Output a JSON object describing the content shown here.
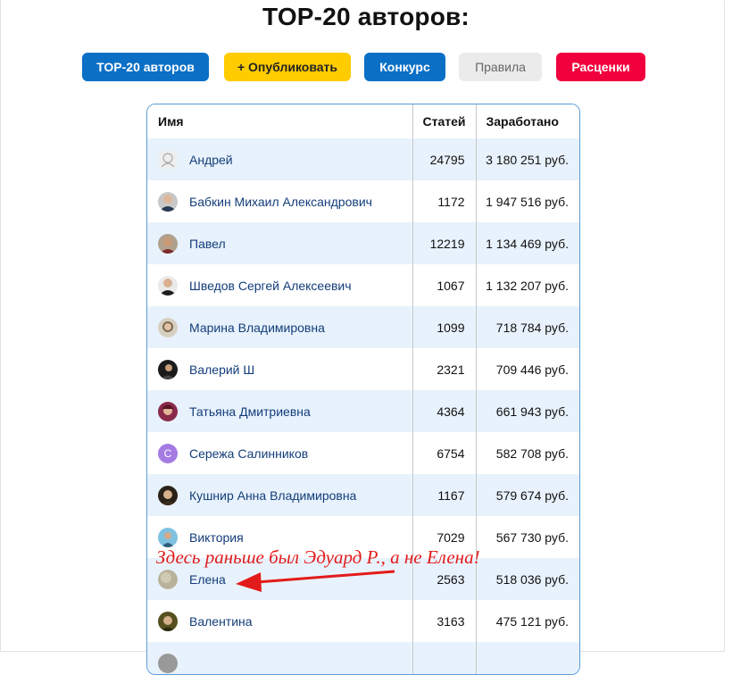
{
  "page": {
    "title": "TOP-20 авторов:"
  },
  "nav": {
    "top": "TOP-20 авторов",
    "publish": "+ Опубликовать",
    "contest": "Конкурс",
    "rules": "Правила",
    "prices": "Расценки"
  },
  "table": {
    "headers": {
      "name": "Имя",
      "articles": "Статей",
      "earned": "Заработано"
    },
    "rows": [
      {
        "name": "Андрей",
        "articles": "24795",
        "earned": "3 180 251 руб.",
        "avatar": "default-avatar-icon"
      },
      {
        "name": "Бабкин Михаил Александрович",
        "articles": "1172",
        "earned": "1 947 516 руб.",
        "avatar": "photo"
      },
      {
        "name": "Павел",
        "articles": "12219",
        "earned": "1 134 469 руб.",
        "avatar": "photo"
      },
      {
        "name": "Шведов Сергей Алексеевич",
        "articles": "1067",
        "earned": "1 132 207 руб.",
        "avatar": "photo"
      },
      {
        "name": "Марина Владимировна",
        "articles": "1099",
        "earned": "718 784 руб.",
        "avatar": "photo"
      },
      {
        "name": "Валерий Ш",
        "articles": "2321",
        "earned": "709 446 руб.",
        "avatar": "photo"
      },
      {
        "name": "Татьяна Дмитриевна",
        "articles": "4364",
        "earned": "661 943 руб.",
        "avatar": "photo"
      },
      {
        "name": "Сережа Салинников",
        "articles": "6754",
        "earned": "582 708 руб.",
        "avatar": "letter",
        "letter": "С"
      },
      {
        "name": "Кушнир Анна Владимировна",
        "articles": "1167",
        "earned": "579 674 руб.",
        "avatar": "photo"
      },
      {
        "name": "Виктория",
        "articles": "7029",
        "earned": "567 730 руб.",
        "avatar": "photo"
      },
      {
        "name": "Елена",
        "articles": "2563",
        "earned": "518 036 руб.",
        "avatar": "photo"
      },
      {
        "name": "Валентина",
        "articles": "3163",
        "earned": "475 121 руб.",
        "avatar": "photo"
      },
      {
        "name": "",
        "articles": "",
        "earned": "",
        "avatar": "photo"
      }
    ]
  },
  "annotation": {
    "text": "Здесь раньше был Эдуард Р., а не Елена!",
    "color": "#e21b1b"
  },
  "colors": {
    "primary": "#0a6fc5",
    "publish": "#ffcc00",
    "rules": "#ebebeb",
    "prices": "#f0003c",
    "row_alt": "#e8f2fc",
    "link": "#133d7a"
  }
}
